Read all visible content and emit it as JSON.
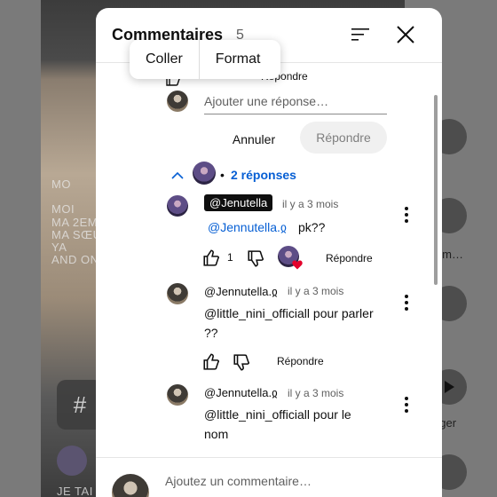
{
  "background": {
    "overlay_lines": [
      "MO",
      "MOI",
      "MA 2EM",
      "MA SŒUR",
      "YA",
      "AND ON"
    ],
    "hash_symbol": "#",
    "bottom_caption": "JE TAI",
    "rail_labels": [
      "aim…",
      "ager"
    ]
  },
  "context_menu": {
    "paste_label": "Coller",
    "format_label": "Format"
  },
  "header": {
    "title": "Commentaires",
    "count": "5"
  },
  "reply_composer": {
    "partial_label": "Répondre",
    "placeholder": "Ajouter une réponse…",
    "cancel_label": "Annuler",
    "submit_label": "Répondre"
  },
  "replies_toggle": {
    "label": "2 réponses",
    "bullet": "•"
  },
  "comments": [
    {
      "author": "@Jenutella",
      "time": "il y a 3 mois",
      "mention": "@Jennutella.ჲ",
      "text": "pk??",
      "likes": "1",
      "reply_label": "Répondre"
    },
    {
      "author": "@Jennutella.ჲ",
      "time": "il y a 3 mois",
      "text_line1": "@little_nini_officiall pour parler",
      "text_line2": "??",
      "reply_label": "Répondre"
    },
    {
      "author": "@Jennutella.ჲ",
      "time": "il y a 3 mois",
      "text_line1": "@little_nini_officiall pour le",
      "text_line2": "nom"
    }
  ],
  "footer": {
    "placeholder": "Ajoutez un commentaire…"
  },
  "colors": {
    "link": "#065fd4",
    "heart": "#e3002b",
    "chip_bg": "#0f0f0f"
  },
  "icons": [
    "filter-icon",
    "close-icon",
    "thumbs-up-icon",
    "thumbs-down-icon",
    "chevron-up-icon",
    "kebab-menu-icon",
    "heart-icon"
  ]
}
